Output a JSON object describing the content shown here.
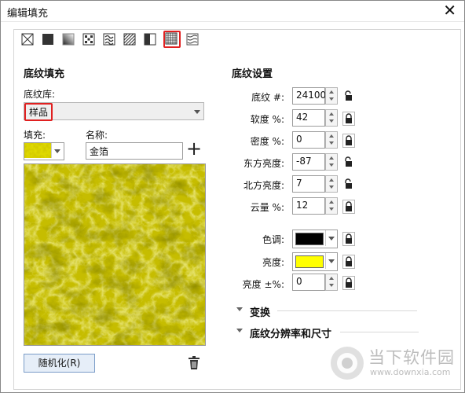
{
  "window": {
    "title": "编辑填充",
    "close_glyph": "✕"
  },
  "toolbar": {
    "items": [
      {
        "name": "no-fill-icon"
      },
      {
        "name": "uniform-fill-icon"
      },
      {
        "name": "fountain-fill-icon"
      },
      {
        "name": "vector-pattern-icon"
      },
      {
        "name": "bitmap-pattern-icon"
      },
      {
        "name": "two-color-pattern-icon"
      },
      {
        "name": "texture-fill-icon"
      },
      {
        "name": "postscript-fill-icon"
      },
      {
        "name": "extra-fill-icon"
      }
    ],
    "active_index": 7,
    "accent_color": "#e02020"
  },
  "left": {
    "heading": "底纹填充",
    "library_label": "底纹库:",
    "library_value": "样品",
    "fill_label": "填充:",
    "name_label": "名称:",
    "name_value": "金箔",
    "add_glyph": "+",
    "randomize_label": "随机化(R)",
    "texture_color": "#c8c000"
  },
  "right": {
    "heading": "底纹设置",
    "params": [
      {
        "label": "底纹 #:",
        "value": "24100",
        "lock": "plain"
      },
      {
        "label": "软度 %:",
        "value": "42",
        "lock": "boxed"
      },
      {
        "label": "密度 %:",
        "value": "0",
        "lock": "boxed"
      },
      {
        "label": "东方亮度:",
        "value": "-87",
        "lock": "plain"
      },
      {
        "label": "北方亮度:",
        "value": "7",
        "lock": "plain"
      },
      {
        "label": "云量 %:",
        "value": "12",
        "lock": "boxed"
      }
    ],
    "hue_label": "色调:",
    "hue_color": "#000000",
    "brightness_label": "亮度:",
    "brightness_color": "#ffff00",
    "brightness_pm_label": "亮度 ±%:",
    "brightness_pm_value": "0"
  },
  "sections": {
    "transform": "变换",
    "resolution": "底纹分辨率和尺寸"
  },
  "watermark": {
    "text": "当下软件园",
    "url": "www.downxia.com"
  }
}
